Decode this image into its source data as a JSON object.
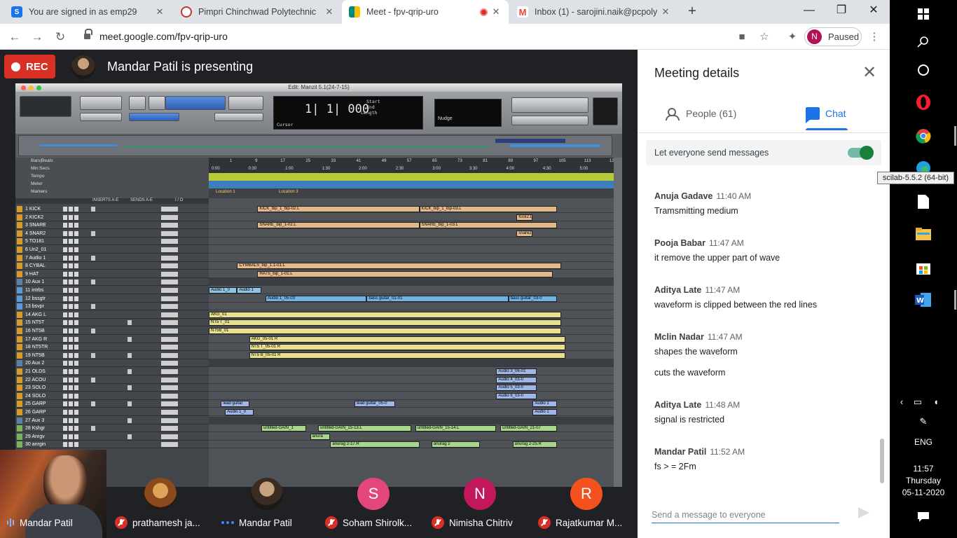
{
  "browser": {
    "tabs": [
      {
        "label": "You are signed in as emp29",
        "icon_color": "#1a73e8",
        "icon_text": "S"
      },
      {
        "label": "Pimpri Chinchwad Polytechnic",
        "icon_color": "#e8e8e8",
        "icon_text": ""
      },
      {
        "label": "Meet - fpv-qrip-uro",
        "icon_color": "#00897b",
        "icon_text": ""
      },
      {
        "label": "Inbox (1) - sarojini.naik@pcpolyte",
        "icon_color": "#ea4335",
        "icon_text": "M"
      }
    ],
    "new_tab": "+",
    "url": "meet.google.com/fpv-qrip-uro",
    "profile_initial": "N",
    "profile_status": "Paused"
  },
  "meet": {
    "rec_label": "REC",
    "presenting_text": "Mandar Patil is presenting",
    "daw": {
      "window_title": "Edit: Manzil 5.1(24-7-15)",
      "counter_main": "1| 1| 000",
      "counter_start": "Start",
      "counter_end": "End",
      "counter_length": "Length",
      "cursor_label": "Cursor",
      "nudge_label": "Nudge",
      "ruler_labels": [
        "Bars|Beats",
        "Min:Secs",
        "Tempo",
        "Meter",
        "Markers"
      ],
      "bar_ticks": [
        "1",
        "9",
        "17",
        "25",
        "33",
        "41",
        "49",
        "57",
        "65",
        "73",
        "81",
        "89",
        "97",
        "105",
        "113",
        "121"
      ],
      "time_ticks": [
        "0:00",
        "0:30",
        "1:00",
        "1:30",
        "2:00",
        "2:30",
        "3:00",
        "3:30",
        "4:00",
        "4:30",
        "5:00"
      ],
      "markers": [
        "Location 1",
        "Location 3"
      ],
      "header_labels": [
        "INSERTS A-E",
        "SENDS A-E",
        "I / O"
      ],
      "tracks": [
        {
          "n": "1",
          "name": "KICK"
        },
        {
          "n": "2",
          "name": "KICK2"
        },
        {
          "n": "3",
          "name": "SNARE"
        },
        {
          "n": "4",
          "name": "SNAR2"
        },
        {
          "n": "5",
          "name": "TO181"
        },
        {
          "n": "6",
          "name": "Un2_01"
        },
        {
          "n": "7",
          "name": "Audio 1"
        },
        {
          "n": "8",
          "name": "CYBAL"
        },
        {
          "n": "9",
          "name": "HAT"
        },
        {
          "n": "10",
          "name": "Aux 1"
        },
        {
          "n": "11",
          "name": "intrbs"
        },
        {
          "n": "12",
          "name": "bssgtr"
        },
        {
          "n": "13",
          "name": "bsvpr"
        },
        {
          "n": "14",
          "name": "AKG L"
        },
        {
          "n": "15",
          "name": "NT5T"
        },
        {
          "n": "16",
          "name": "NT5B"
        },
        {
          "n": "17",
          "name": "AKG R"
        },
        {
          "n": "18",
          "name": "NT5TR"
        },
        {
          "n": "19",
          "name": "NT5B"
        },
        {
          "n": "20",
          "name": "Aux 2"
        },
        {
          "n": "21",
          "name": "OLDS"
        },
        {
          "n": "22",
          "name": "ACOU"
        },
        {
          "n": "23",
          "name": "SOLO"
        },
        {
          "n": "24",
          "name": "SOLO"
        },
        {
          "n": "25",
          "name": "GARP"
        },
        {
          "n": "26",
          "name": "GARP"
        },
        {
          "n": "27",
          "name": "Aux 3"
        },
        {
          "n": "28",
          "name": "Kshgr"
        },
        {
          "n": "29",
          "name": "Anrgv"
        },
        {
          "n": "30",
          "name": "anrgin"
        }
      ],
      "clips": [
        {
          "lane": 0,
          "label": "KICK_bip_1_bip-02.L",
          "color": "#e3b98a",
          "from": 0.12,
          "to": 0.52
        },
        {
          "lane": 0,
          "label": "KICK_bip_1_bip-03.L",
          "color": "#e3b98a",
          "from": 0.52,
          "to": 0.86
        },
        {
          "lane": 1,
          "label": "Kick2.L",
          "color": "#e3b98a",
          "from": 0.76,
          "to": 0.8
        },
        {
          "lane": 2,
          "label": "SNARE_bip_1-02.L",
          "color": "#e3b98a",
          "from": 0.12,
          "to": 0.52
        },
        {
          "lane": 2,
          "label": "SNARE_bip_1-03.L",
          "color": "#e3b98a",
          "from": 0.52,
          "to": 0.86
        },
        {
          "lane": 3,
          "label": "snare2",
          "color": "#e3b98a",
          "from": 0.76,
          "to": 0.8
        },
        {
          "lane": 7,
          "label": "CYMBALS_bip_1.1-01.L",
          "color": "#e3b98a",
          "from": 0.07,
          "to": 0.87
        },
        {
          "lane": 8,
          "label": "HATS_bip_1-01.L",
          "color": "#e3b98a",
          "from": 0.12,
          "to": 0.85
        },
        {
          "lane": 10,
          "label": "Audio 1_0",
          "color": "#8ec3e6",
          "from": 0.0,
          "to": 0.07
        },
        {
          "lane": 10,
          "label": "Audio 1",
          "color": "#8ec3e6",
          "from": 0.07,
          "to": 0.13
        },
        {
          "lane": 11,
          "label": "Audio 1_05-03",
          "color": "#6fb3e3",
          "from": 0.14,
          "to": 0.39
        },
        {
          "lane": 11,
          "label": "bass guitar_01-01",
          "color": "#6fb3e3",
          "from": 0.39,
          "to": 0.74
        },
        {
          "lane": 11,
          "label": "bass guitar_03-0",
          "color": "#6fb3e3",
          "from": 0.74,
          "to": 0.86
        },
        {
          "lane": 13,
          "label": "AKG_01",
          "color": "#e8df8f",
          "from": 0.0,
          "to": 0.87
        },
        {
          "lane": 14,
          "label": "NT5 T_01",
          "color": "#e8df8f",
          "from": 0.0,
          "to": 0.87
        },
        {
          "lane": 15,
          "label": "NT5B_01",
          "color": "#e8df8f",
          "from": 0.0,
          "to": 0.87
        },
        {
          "lane": 16,
          "label": "AKG_05-01 R",
          "color": "#e8df8f",
          "from": 0.1,
          "to": 0.88
        },
        {
          "lane": 17,
          "label": "NT5 T_05-01 R",
          "color": "#e8df8f",
          "from": 0.1,
          "to": 0.88
        },
        {
          "lane": 18,
          "label": "NT5 B_05-01 R",
          "color": "#e8df8f",
          "from": 0.1,
          "to": 0.88
        },
        {
          "lane": 20,
          "label": "Audio 3_06-01",
          "color": "#9fb7e8",
          "from": 0.71,
          "to": 0.81
        },
        {
          "lane": 21,
          "label": "Audio 4_03-0",
          "color": "#9fb7e8",
          "from": 0.71,
          "to": 0.81
        },
        {
          "lane": 22,
          "label": "Audio 5_03-0",
          "color": "#9fb7e8",
          "from": 0.71,
          "to": 0.81
        },
        {
          "lane": 23,
          "label": "Audio 6_03-0",
          "color": "#9fb7e8",
          "from": 0.71,
          "to": 0.81
        },
        {
          "lane": 24,
          "label": "lead guitar",
          "color": "#9fb7e8",
          "from": 0.03,
          "to": 0.1
        },
        {
          "lane": 24,
          "label": "lead guitar_05-0",
          "color": "#9fb7e8",
          "from": 0.36,
          "to": 0.46
        },
        {
          "lane": 24,
          "label": "Audio 1",
          "color": "#9fb7e8",
          "from": 0.8,
          "to": 0.86
        },
        {
          "lane": 25,
          "label": "Audio 1_0",
          "color": "#9fb7e8",
          "from": 0.04,
          "to": 0.11
        },
        {
          "lane": 25,
          "label": "Audio 1",
          "color": "#9fb7e8",
          "from": 0.8,
          "to": 0.86
        },
        {
          "lane": 27,
          "label": "untitled-GAIN_1",
          "color": "#a7d68c",
          "from": 0.13,
          "to": 0.24
        },
        {
          "lane": 27,
          "label": "untitled-GAIN_15-13.L",
          "color": "#a7d68c",
          "from": 0.27,
          "to": 0.5
        },
        {
          "lane": 27,
          "label": "untitled-GAIN_15-14.L",
          "color": "#a7d68c",
          "from": 0.51,
          "to": 0.71
        },
        {
          "lane": 27,
          "label": "untitled-GAIN_21-07",
          "color": "#a7d68c",
          "from": 0.72,
          "to": 0.86
        },
        {
          "lane": 28,
          "label": "anura",
          "color": "#a7d68c",
          "from": 0.25,
          "to": 0.3
        },
        {
          "lane": 29,
          "label": "anurag 2-17.R",
          "color": "#a7d68c",
          "from": 0.3,
          "to": 0.52
        },
        {
          "lane": 29,
          "label": "anurag 2",
          "color": "#a7d68c",
          "from": 0.55,
          "to": 0.67
        },
        {
          "lane": 29,
          "label": "anurag 2-25.R",
          "color": "#a7d68c",
          "from": 0.75,
          "to": 0.86
        }
      ]
    },
    "participants": [
      {
        "name": "Mandar Patil",
        "type": "self",
        "state": "talking"
      },
      {
        "name": "prathamesh ja...",
        "type": "photo",
        "state": "muted",
        "avatar_color": "#8a4a1c"
      },
      {
        "name": "Mandar Patil",
        "type": "photo",
        "state": "speaking",
        "avatar_color": "#3a2c22"
      },
      {
        "name": "Soham Shirolk...",
        "type": "initial",
        "initial": "S",
        "state": "muted",
        "avatar_color": "#e2467b"
      },
      {
        "name": "Nimisha Chitriv",
        "type": "initial",
        "initial": "N",
        "state": "muted",
        "avatar_color": "#c2185b"
      },
      {
        "name": "Rajatkumar M...",
        "type": "initial",
        "initial": "R",
        "state": "muted",
        "avatar_color": "#f4511e"
      }
    ]
  },
  "panel": {
    "title": "Meeting details",
    "tab_people": "People (61)",
    "tab_chat": "Chat",
    "toggle_label": "Let everyone send messages",
    "toggle_on": true,
    "messages": [
      {
        "sender": "Anuja Gadave",
        "time": "11:40 AM",
        "lines": [
          "Tramsmitting medium"
        ]
      },
      {
        "sender": "Pooja Babar",
        "time": "11:47 AM",
        "lines": [
          "it remove  the upper part of wave"
        ]
      },
      {
        "sender": "Aditya Late",
        "time": "11:47 AM",
        "lines": [
          "waveform is clipped between the red lines"
        ]
      },
      {
        "sender": "Mclin Nadar",
        "time": "11:47 AM",
        "lines": [
          "shapes the waveform",
          "cuts the waveform"
        ]
      },
      {
        "sender": "Aditya Late",
        "time": "11:48 AM",
        "lines": [
          "signal is restricted"
        ]
      },
      {
        "sender": "Mandar Patil",
        "time": "11:52 AM",
        "lines": [
          "fs > = 2Fm"
        ]
      }
    ],
    "compose_placeholder": "Send a message to everyone"
  },
  "taskbar": {
    "tooltip": "scilab-5.5.2 (64-bit)",
    "language": "ENG",
    "time": "11:57",
    "day": "Thursday",
    "date": "05-11-2020"
  }
}
